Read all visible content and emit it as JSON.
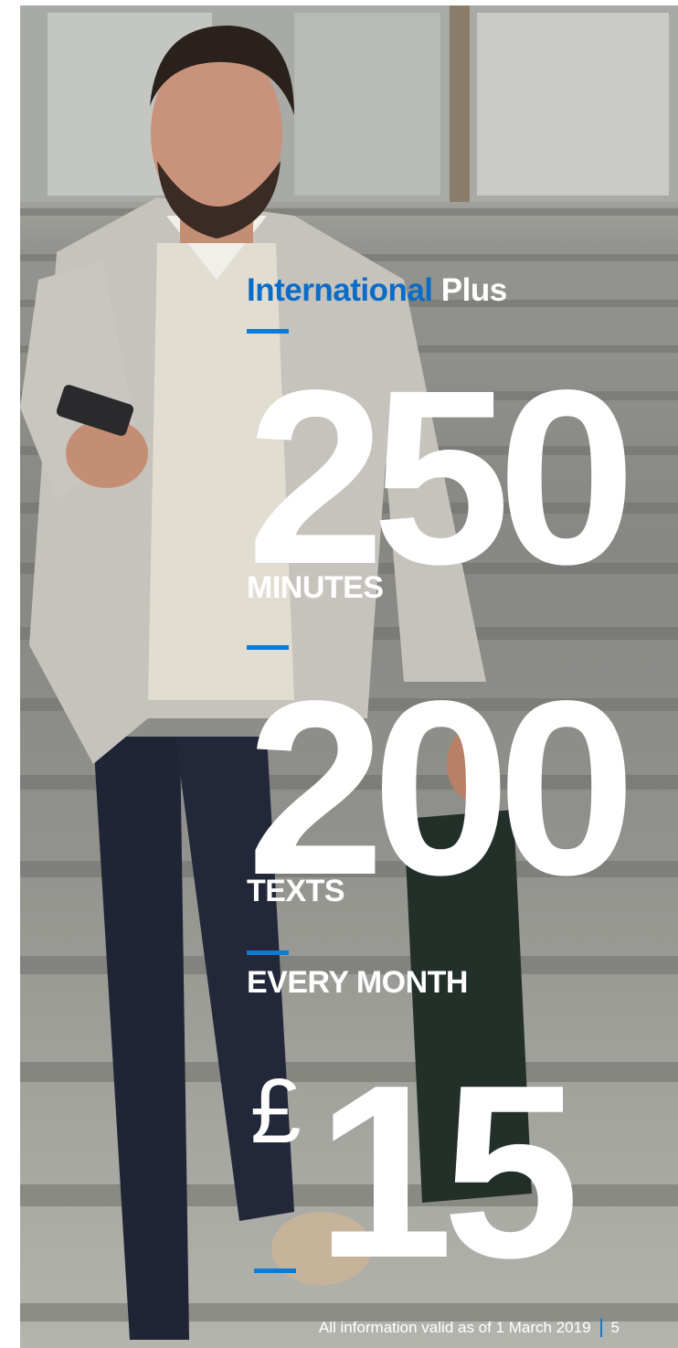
{
  "plan": {
    "name_part1": "International",
    "name_part2": "Plus",
    "minutes_value": "250",
    "minutes_label": "MINUTES",
    "texts_value": "200",
    "texts_label": "TEXTS",
    "frequency": "EVERY MONTH",
    "currency": "£",
    "price": "15"
  },
  "footer": {
    "note": "All information valid as of 1 March 2019",
    "page_number": "5"
  },
  "colors": {
    "accent": "#0a6cc9",
    "text": "#ffffff"
  },
  "icons": [
    "photo-man-on-stairs"
  ]
}
